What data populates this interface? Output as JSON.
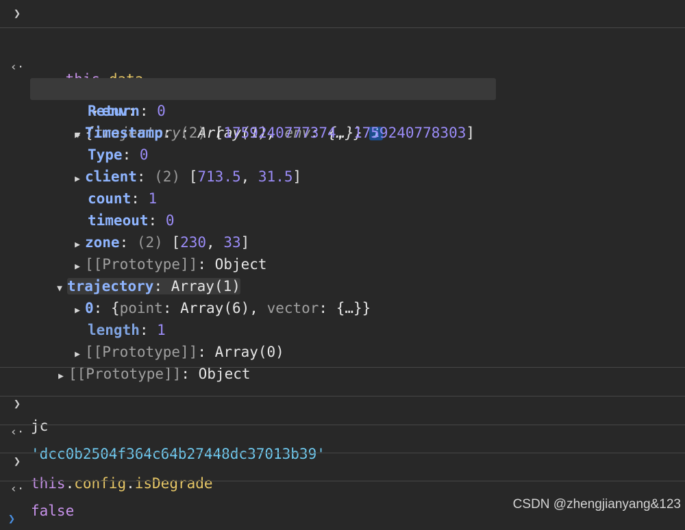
{
  "console": {
    "cmd1": {
      "this": "this",
      "dot": ".",
      "prop": "data"
    },
    "obj_summary": {
      "open": "{",
      "k1": "trajectory",
      "colon": ": ",
      "v1": "Array(1)",
      "comma": ", ",
      "k2": "env",
      "v2": "{…}",
      "close": "}",
      "badge": "i"
    },
    "env": {
      "label": "env",
      "colon": ":",
      "return": {
        "key": "Return",
        "value": "0"
      },
      "timestamp": {
        "key": "Timestamp",
        "count": "(2)",
        "values": [
          "1759240777374",
          "1759240778303"
        ]
      },
      "type": {
        "key": "Type",
        "value": "0"
      },
      "client": {
        "key": "client",
        "count": "(2)",
        "values": [
          "713.5",
          "31.5"
        ]
      },
      "count": {
        "key": "count",
        "value": "1"
      },
      "timeout": {
        "key": "timeout",
        "value": "0"
      },
      "zone": {
        "key": "zone",
        "count": "(2)",
        "values": [
          "230",
          "33"
        ]
      },
      "proto": {
        "key": "[[Prototype]]",
        "value": "Object"
      }
    },
    "trajectory": {
      "key": "trajectory",
      "value": "Array(1)",
      "item0": {
        "key": "0",
        "k1": "point",
        "v1": "Array(6)",
        "k2": "vector",
        "v2": "{…}"
      },
      "length": {
        "key": "length",
        "value": "1"
      },
      "proto": {
        "key": "[[Prototype]]",
        "value": "Array(0)"
      }
    },
    "root_proto": {
      "key": "[[Prototype]]",
      "value": "Object"
    },
    "cmd2": "jc",
    "result2": "'dcc0b2504f364c64b27448dc37013b39'",
    "cmd3": {
      "this": "this",
      "dot1": ".",
      "p1": "config",
      "dot2": ".",
      "p2": "isDegrade"
    },
    "result3": "false"
  },
  "watermark": "CSDN @zhengjianyang&123"
}
